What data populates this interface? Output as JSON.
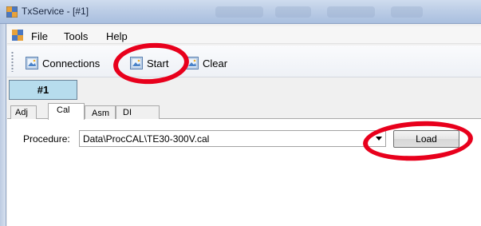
{
  "window": {
    "title": "TxService - [#1]",
    "icon": "app-icon"
  },
  "menu": {
    "items": [
      {
        "label": "File"
      },
      {
        "label": "Tools"
      },
      {
        "label": "Help"
      }
    ]
  },
  "toolbar": {
    "connections_label": "Connections",
    "start_label": "Start",
    "clear_label": "Clear",
    "button_icon": "image-icon"
  },
  "document_tab": {
    "label": "#1"
  },
  "tabs": [
    {
      "label": "Adj",
      "active": false
    },
    {
      "label": "Cal",
      "active": true
    },
    {
      "label": "Asm",
      "active": false
    },
    {
      "label": "DI",
      "active": false
    }
  ],
  "cal": {
    "procedure_label": "Procedure:",
    "procedure_value": "Data\\ProcCAL\\TE30-300V.cal",
    "load_label": "Load"
  },
  "colors": {
    "annotation": "#e8001c",
    "document_tab": "#b7dced",
    "title_bar": "#bccde6"
  }
}
